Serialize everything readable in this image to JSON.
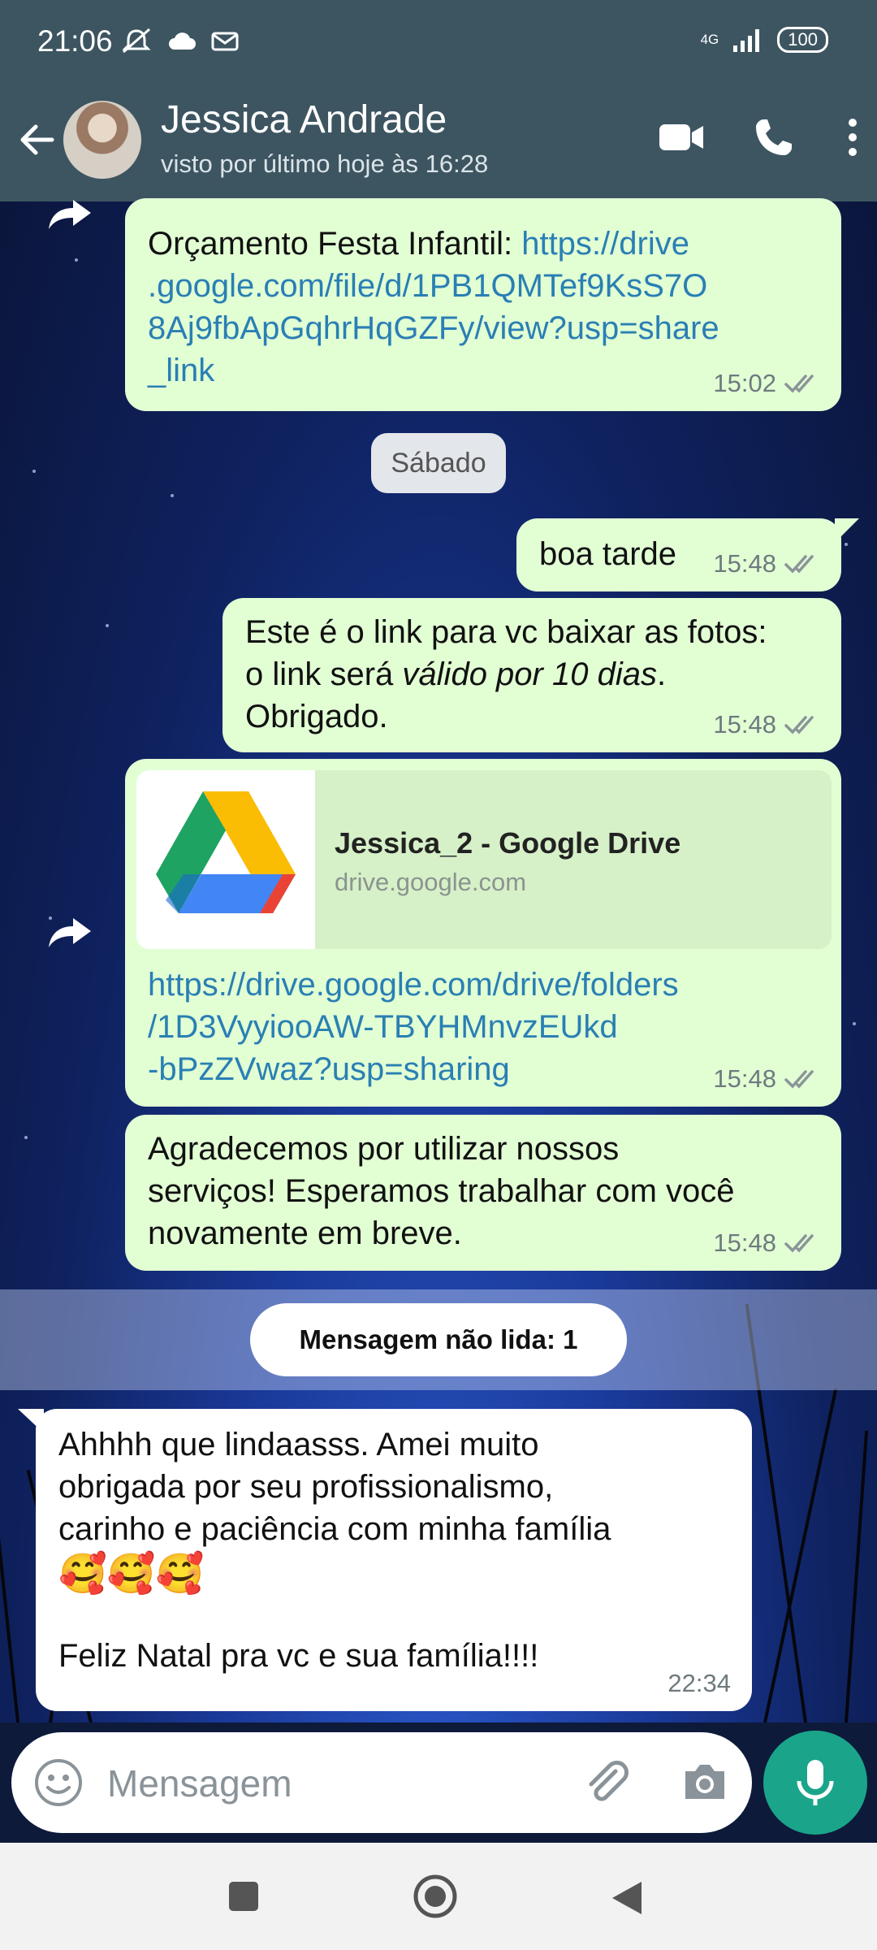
{
  "status_bar": {
    "time": "21:06",
    "network": "4G",
    "battery": "100"
  },
  "header": {
    "contact_name": "Jessica Andrade",
    "last_seen": "visto por último hoje às 16:28"
  },
  "messages": {
    "m1": {
      "text_prefix": "Orçamento Festa Infantil: ",
      "link_line1": "https://drive",
      "link_line2": ".google.com/file/d/1PB1QMTef9KsS7O",
      "link_line3": "8Aj9fbApGqhrHqGZFy/view?usp=share",
      "link_line4": "_link",
      "time": "15:02"
    },
    "day_separator": "Sábado",
    "m2": {
      "text": "boa tarde",
      "time": "15:48"
    },
    "m3": {
      "line1": "Este é o link para vc baixar as fotos:",
      "line2_prefix": "o link será ",
      "line2_italic": "válido por 10 dias",
      "line2_suffix": ".",
      "line3": "Obrigado.",
      "time": "15:48"
    },
    "m4": {
      "preview_title": "Jessica_2 - Google Drive",
      "preview_domain": "drive.google.com",
      "link_line1": "https://drive.google.com/drive/folders",
      "link_line2": "/1D3VyyiooAW-TBYHMnvzEUkd",
      "link_line3": "-bPzZVwaz?usp=sharing",
      "time": "15:48"
    },
    "m5": {
      "line1": "Agradecemos por utilizar nossos",
      "line2": "serviços! Esperamos trabalhar com você",
      "line3": "novamente em breve.",
      "time": "15:48"
    },
    "unread_label": "Mensagem não lida: 1",
    "m6": {
      "line1": "Ahhhh que lindaasss. Amei muito",
      "line2": "obrigada por seu profissionalismo,",
      "line3": "carinho e paciência com minha família",
      "emojis": "🥰🥰🥰",
      "line5": "Feliz Natal pra vc e sua família!!!!",
      "time": "22:34"
    }
  },
  "input": {
    "placeholder": "Mensagem"
  },
  "colors": {
    "header_bg": "#3d5561",
    "outgoing_bubble": "#e2ffd4",
    "incoming_bubble": "#ffffff",
    "link": "#2a7fb4",
    "mic_button": "#1aa58a"
  },
  "icons": [
    "back-arrow-icon",
    "video-call-icon",
    "phone-icon",
    "more-options-icon",
    "forward-icon",
    "double-check-icon",
    "google-drive-icon",
    "emoji-icon",
    "attach-icon",
    "camera-icon",
    "mic-icon",
    "recents-icon",
    "home-icon",
    "back-icon"
  ]
}
